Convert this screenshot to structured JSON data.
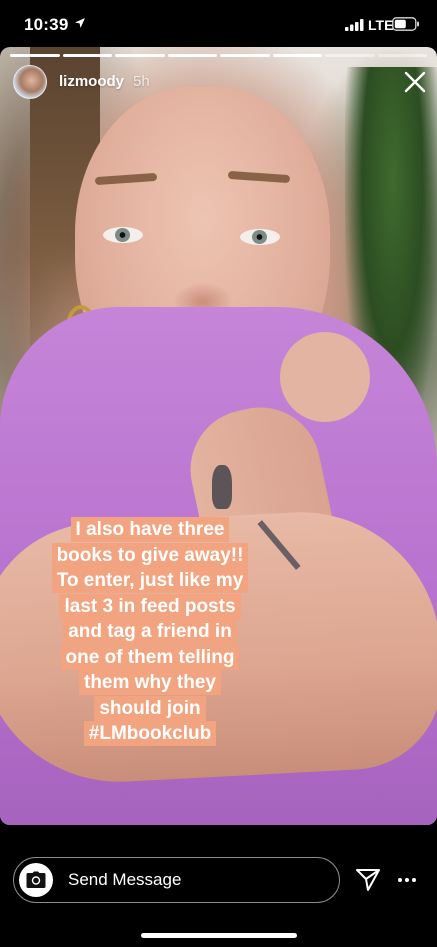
{
  "status_bar": {
    "time": "10:39",
    "network": "LTE"
  },
  "story": {
    "progress_segments": 8,
    "progress_filled": 6,
    "username": "lizmoody",
    "time_ago": "5h",
    "caption_lines": [
      "I also have three",
      "books to give away!!",
      "To enter, just like my",
      "last 3 in feed posts",
      "and tag a friend in",
      "one of them telling",
      "them why they",
      "should join",
      "#LMbookclub"
    ],
    "caption_highlight_color": "#f2a37f"
  },
  "bottom_bar": {
    "message_placeholder": "Send Message"
  },
  "icons": {
    "close": "close-icon",
    "camera": "camera-icon",
    "send": "send-icon",
    "more": "more-icon",
    "location": "location-arrow-icon",
    "signal": "signal-icon",
    "battery": "battery-icon"
  }
}
